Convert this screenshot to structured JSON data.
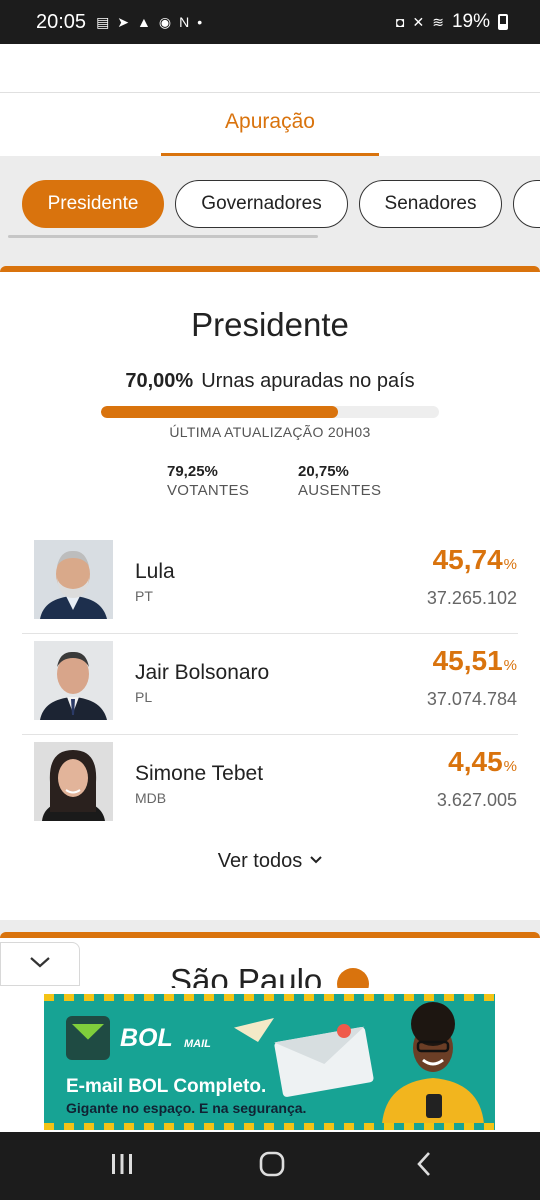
{
  "status_bar": {
    "time": "20:05",
    "battery": "19%"
  },
  "header": {
    "active_tab": "Apuração"
  },
  "filters": [
    {
      "label": "Presidente",
      "active": true
    },
    {
      "label": "Governadores",
      "active": false
    },
    {
      "label": "Senadores",
      "active": false
    }
  ],
  "card": {
    "title": "Presidente",
    "urnas_pct": "70,00%",
    "urnas_label": "Urnas apuradas no país",
    "progress": 0.7,
    "updated": "ÚLTIMA ATUALIZAÇÃO 20H03",
    "votantes_value": "79,25%",
    "votantes_label": "VOTANTES",
    "ausentes_value": "20,75%",
    "ausentes_label": "AUSENTES",
    "candidates": [
      {
        "name": "Lula",
        "party": "PT",
        "pct": "45,74",
        "unit": "%",
        "votes": "37.265.102"
      },
      {
        "name": "Jair Bolsonaro",
        "party": "PL",
        "pct": "45,51",
        "unit": "%",
        "votes": "37.074.784"
      },
      {
        "name": "Simone Tebet",
        "party": "MDB",
        "pct": "4,45",
        "unit": "%",
        "votes": "3.627.005"
      }
    ],
    "see_all": "Ver todos"
  },
  "next_card": {
    "title": "São Paulo"
  },
  "ad": {
    "brand": "BOL",
    "brand_sub": "MAIL",
    "line1": "E-mail BOL Completo.",
    "line2": "Gigante no espaço. E na segurança."
  },
  "colors": {
    "accent": "#d9730d",
    "ad_bg": "#17a394",
    "ad_stripe": "#f3c316"
  }
}
